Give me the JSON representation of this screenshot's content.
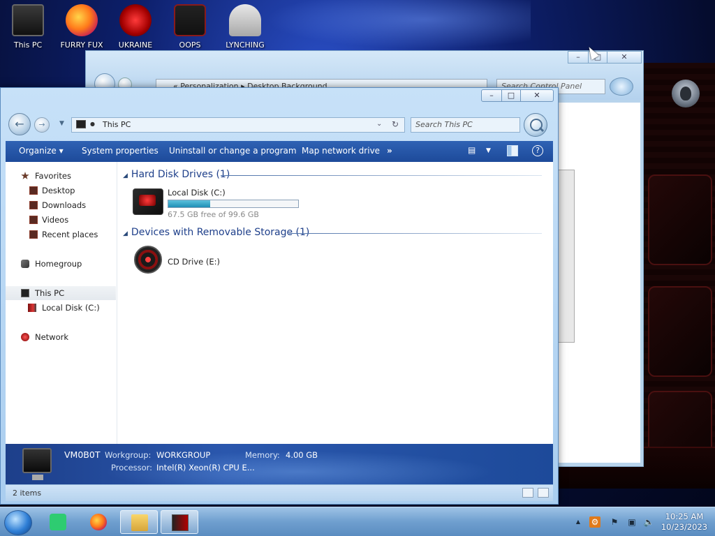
{
  "desktop": {
    "icons": [
      {
        "label": "This PC"
      },
      {
        "label": "FURRY FUX"
      },
      {
        "label": "UKRAINE"
      },
      {
        "label": "OOPS"
      },
      {
        "label": "LYNCHING"
      }
    ]
  },
  "background_window": {
    "breadcrumb": "« Personalization ▸ Desktop Background",
    "search_placeholder": "Search Control Panel"
  },
  "window": {
    "buttons": {
      "minimize": "–",
      "maximize": "□",
      "close": "✕"
    },
    "address": {
      "text": "This PC"
    },
    "search": {
      "placeholder": "Search This PC"
    },
    "toolbar": {
      "organize": "Organize ▾",
      "system_properties": "System properties",
      "uninstall": "Uninstall or change a program",
      "map_drive": "Map network drive",
      "more": "»"
    },
    "nav_pane": {
      "favorites": "Favorites",
      "desktop": "Desktop",
      "downloads": "Downloads",
      "videos": "Videos",
      "recent_places": "Recent places",
      "homegroup": "Homegroup",
      "this_pc": "This PC",
      "local_disk": "Local Disk (C:)",
      "network": "Network"
    },
    "groups": {
      "hard_disk": "Hard Disk Drives (1)",
      "removable": "Devices with Removable Storage (1)"
    },
    "drives": {
      "local_disk": {
        "name": "Local Disk (C:)",
        "free": "67.5 GB free of 99.6 GB",
        "used_fraction": 0.322
      },
      "cd_drive": {
        "name": "CD Drive (E:)"
      }
    },
    "details": {
      "computer_name": "VM0B0T",
      "workgroup_label": "Workgroup:",
      "workgroup_value": "WORKGROUP",
      "memory_label": "Memory:",
      "memory_value": "4.00 GB",
      "processor_label": "Processor:",
      "processor_value": "Intel(R) Xeon(R) CPU E..."
    },
    "status": {
      "items": "2 items"
    }
  },
  "taskbar": {
    "clock_time": "10:25 AM",
    "clock_date": "10/23/2023",
    "tray_show_hidden": "▲"
  },
  "colors": {
    "command_bar": "#1d4a9a",
    "group_header": "#1e3f8a",
    "progress_fill": "#1f8fb5"
  }
}
